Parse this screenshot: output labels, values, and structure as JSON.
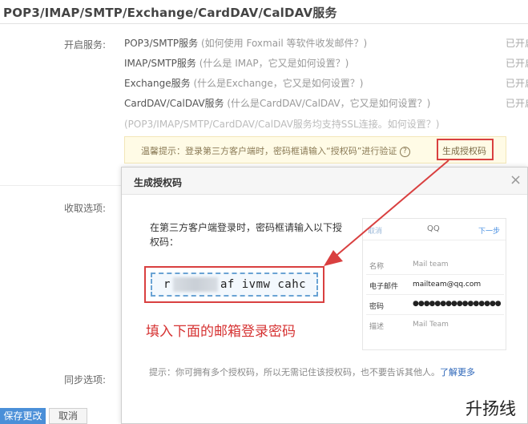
{
  "page": {
    "title": "POP3/IMAP/SMTP/Exchange/CardDAV/CalDAV服务"
  },
  "services": {
    "label": "开启服务:",
    "items": [
      {
        "name": "POP3/SMTP服务",
        "hint": "(如何使用 Foxmail 等软件收发邮件？)",
        "status": "已开启"
      },
      {
        "name": "IMAP/SMTP服务",
        "hint": "(什么是 IMAP，它又是如何设置？)",
        "status": "已开启"
      },
      {
        "name": "Exchange服务",
        "hint": "(什么是Exchange，它又是如何设置？)",
        "status": "已开启"
      },
      {
        "name": "CardDAV/CalDAV服务",
        "hint": "(什么是CardDAV/CalDAV，它又是如何设置？)",
        "status": "已开启"
      }
    ],
    "ssl_note": "(POP3/IMAP/SMTP/CardDAV/CalDAV服务均支持SSL连接。如何设置？)"
  },
  "warm_tip": {
    "text": "温馨提示：登录第三方客户端时，密码框请输入“授权码”进行验证",
    "q_icon": "?",
    "gen_link": "生成授权码"
  },
  "labels": {
    "receive": "收取选项:",
    "sync": "同步选项:"
  },
  "buttons": {
    "save": "保存更改",
    "cancel": "取消"
  },
  "dialog": {
    "title": "生成授权码",
    "close": "×",
    "instruction": "在第三方客户端登录时，密码框请输入以下授权码：",
    "code_prefix": "r",
    "code_suffix": "af ivmw cahc",
    "annotation": "填入下面的邮箱登录密码",
    "tip_text": "提示：你可拥有多个授权码，所以无需记住该授权码，也不要告诉其他人。",
    "tip_link": "了解更多"
  },
  "phone": {
    "nav_cancel": "取消",
    "nav_title": "QQ",
    "nav_next": "下一步",
    "rows": [
      {
        "label": "名称",
        "value": "Mail team"
      },
      {
        "label": "电子邮件",
        "value": "mailteam@qq.com"
      },
      {
        "label": "密码",
        "value": "●●●●●●●●●●●●●●●●"
      },
      {
        "label": "描述",
        "value": "Mail Team"
      }
    ]
  },
  "watermark": {
    "text": "升扬线"
  },
  "colors": {
    "highlight_red": "#d94040",
    "annotation_red": "#d63333",
    "link_blue": "#2a64b8",
    "save_blue": "#4a8fd8"
  }
}
